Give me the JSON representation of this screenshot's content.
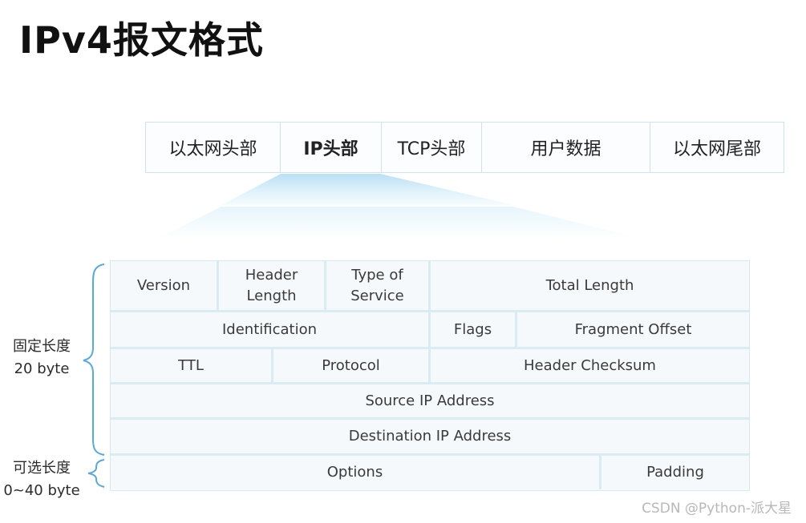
{
  "title": "IPv4报文格式",
  "frame": {
    "segments": [
      "以太网头部",
      "IP头部",
      "TCP头部",
      "用户数据",
      "以太网尾部"
    ],
    "highlighted": "IP头部"
  },
  "header": {
    "row1": {
      "version": "Version",
      "header_length_1": "Header",
      "header_length_2": "Length",
      "tos_1": "Type of",
      "tos_2": "Service",
      "total_length": "Total Length"
    },
    "row2": {
      "identification": "Identification",
      "flags": "Flags",
      "fragment_offset": "Fragment Offset"
    },
    "row3": {
      "ttl": "TTL",
      "protocol": "Protocol",
      "checksum": "Header Checksum"
    },
    "row4": {
      "source": "Source IP Address"
    },
    "row5": {
      "destination": "Destination IP Address"
    },
    "row6": {
      "options": "Options",
      "padding": "Padding"
    }
  },
  "labels": {
    "fixed_1": "固定长度",
    "fixed_2": "20 byte",
    "optional_1": "可选长度",
    "optional_2": "0~40 byte"
  },
  "watermark": "CSDN @Python-派大星",
  "colors": {
    "border": "#d9ecf4",
    "brace": "#5aa8d6",
    "funnel_top": "#bfe3f6",
    "funnel_bottom": "#eef8fd"
  }
}
